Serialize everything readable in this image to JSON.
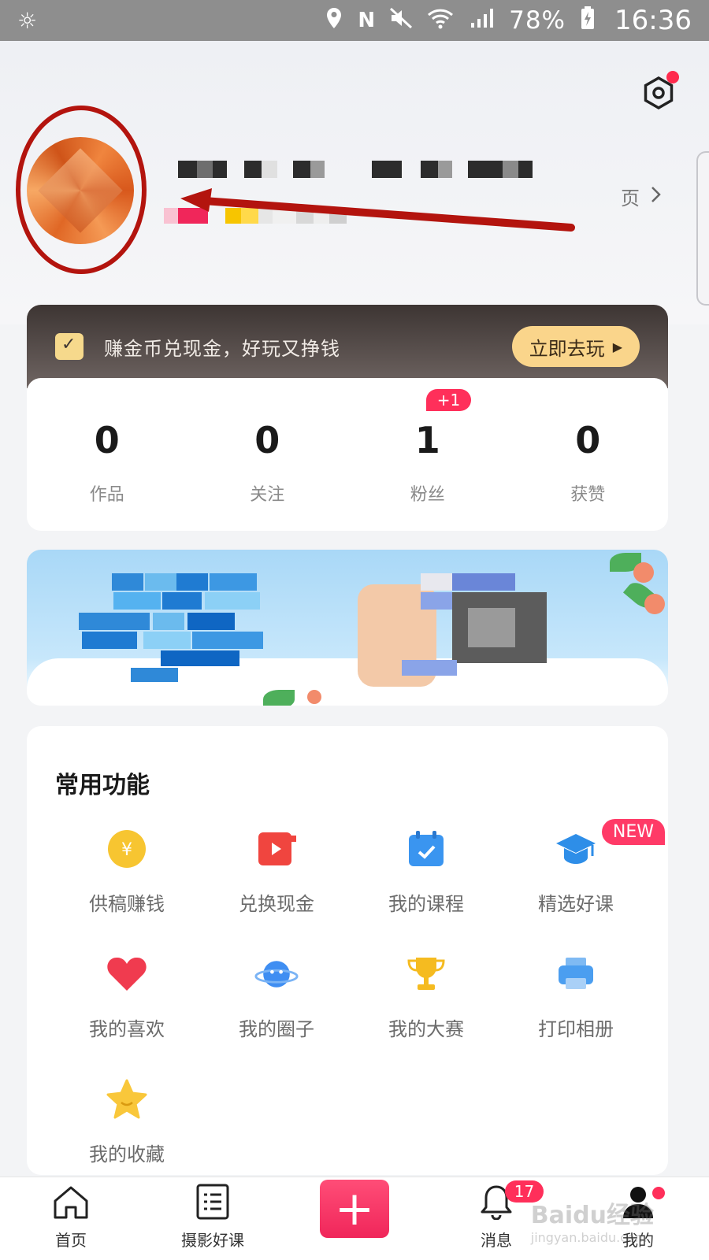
{
  "status_bar": {
    "battery": "78%",
    "time": "16:36",
    "icons": [
      "brightness-icon",
      "location-icon",
      "nfc-icon",
      "mute-icon",
      "wifi-icon",
      "signal-icon",
      "battery-icon"
    ]
  },
  "profile": {
    "homepage_link": "页",
    "settings_icon": "settings-icon"
  },
  "coin_banner": {
    "text": "赚金币兑现金，好玩又挣钱",
    "button": "立即去玩"
  },
  "stats": [
    {
      "value": "0",
      "label": "作品"
    },
    {
      "value": "0",
      "label": "关注"
    },
    {
      "value": "1",
      "label": "粉丝",
      "badge": "+1"
    },
    {
      "value": "0",
      "label": "获赞"
    }
  ],
  "functions": {
    "title": "常用功能",
    "new_badge": "NEW",
    "items": [
      {
        "label": "供稿赚钱",
        "icon": "coin-icon",
        "color": "#f7c531"
      },
      {
        "label": "兑换现金",
        "icon": "video-icon",
        "color": "#f0453f"
      },
      {
        "label": "我的课程",
        "icon": "calendar-icon",
        "color": "#3a95f0"
      },
      {
        "label": "精选好课",
        "icon": "graduation-cap-icon",
        "color": "#2e8ee8"
      },
      {
        "label": "我的喜欢",
        "icon": "heart-icon",
        "color": "#f03b4f"
      },
      {
        "label": "我的圈子",
        "icon": "planet-icon",
        "color": "#3f8ef2"
      },
      {
        "label": "我的大赛",
        "icon": "trophy-icon",
        "color": "#f5bb20"
      },
      {
        "label": "打印相册",
        "icon": "printer-icon",
        "color": "#4b9ef0"
      },
      {
        "label": "我的收藏",
        "icon": "star-icon",
        "color": "#f9c73a"
      }
    ]
  },
  "bottom_nav": [
    {
      "label": "首页",
      "icon": "home-icon"
    },
    {
      "label": "摄影好课",
      "icon": "list-icon"
    },
    {
      "label": "",
      "icon": "plus-icon"
    },
    {
      "label": "消息",
      "icon": "bell-icon",
      "badge": "17"
    },
    {
      "label": "我的",
      "icon": "user-icon"
    }
  ],
  "watermark": {
    "line1": "Baidu经验",
    "line2": "jingyan.baidu.com"
  }
}
